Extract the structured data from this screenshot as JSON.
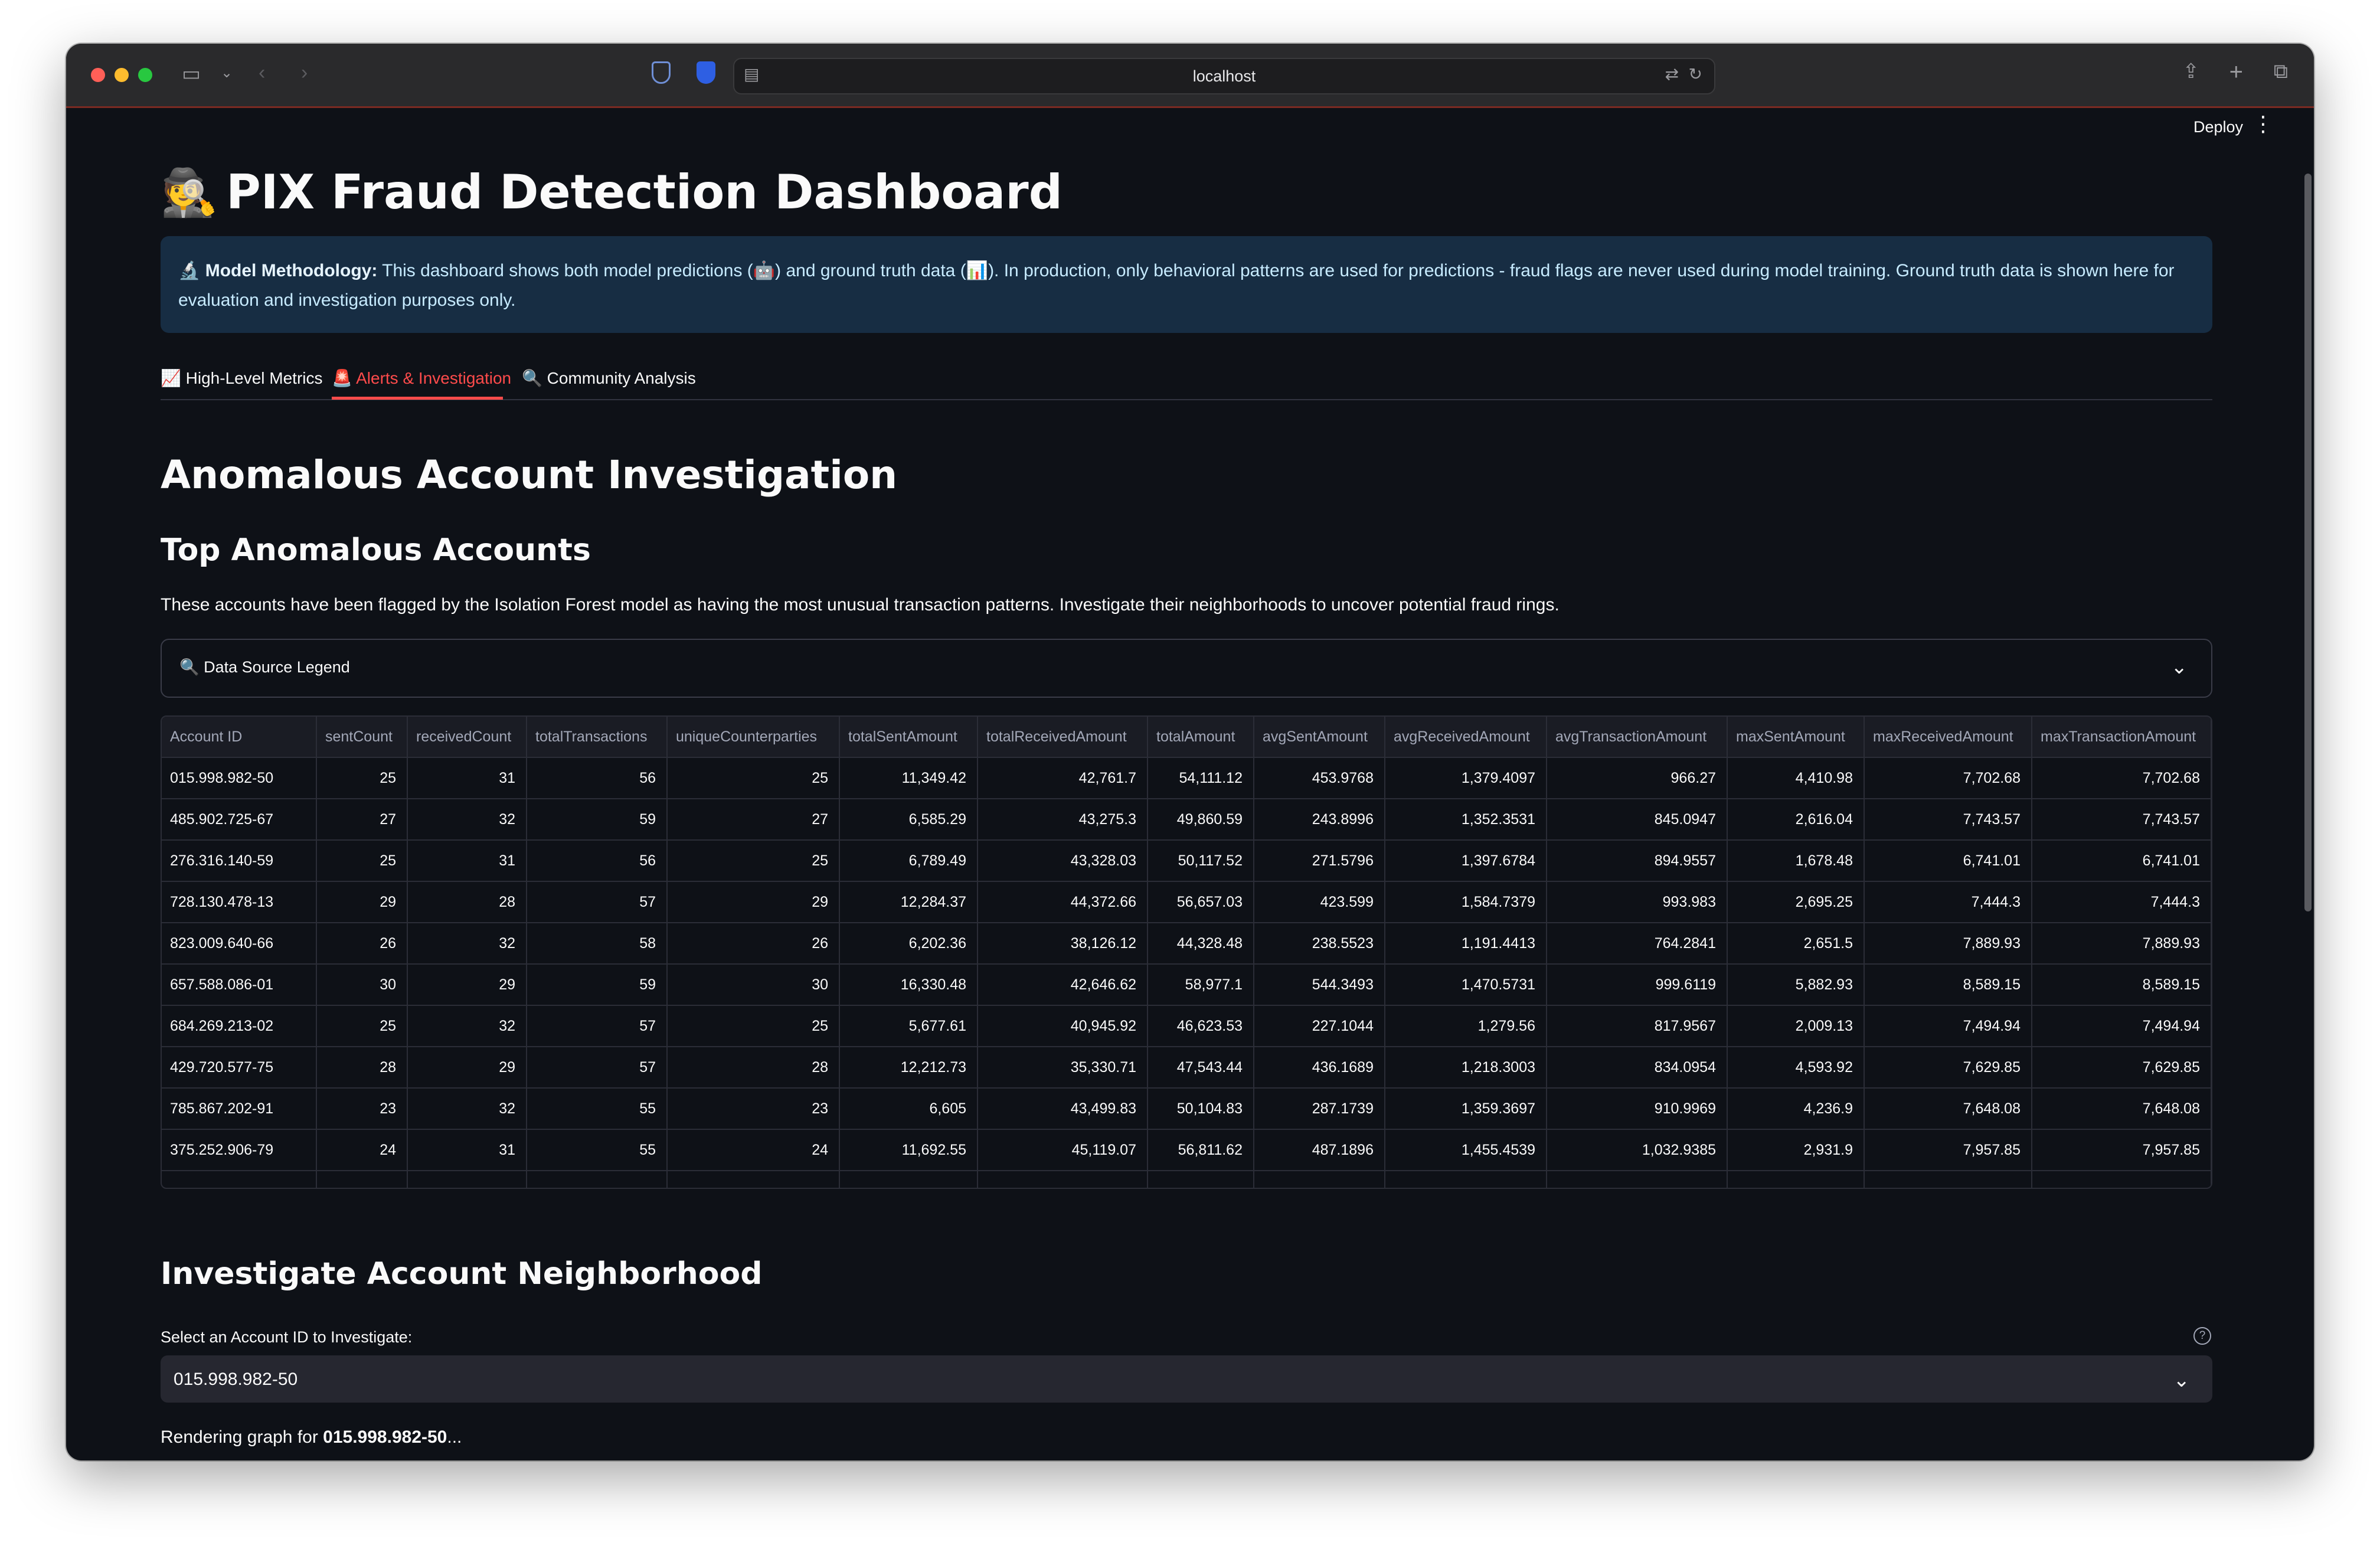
{
  "browser": {
    "url": "localhost"
  },
  "header": {
    "deploy_label": "Deploy"
  },
  "page": {
    "title_icon": "🕵️",
    "title": "PIX Fraud Detection Dashboard",
    "methodology": {
      "icon": "🔬",
      "heading": "Model Methodology:",
      "text_1": " This dashboard shows both model predictions (",
      "robot_icon": "🤖",
      "text_2": ") and ground truth data (",
      "chart_icon": "📊",
      "text_3": "). In production, only behavioral patterns are used for predictions - fraud flags are never used during model training. Ground truth data is shown here for evaluation and investigation purposes only."
    }
  },
  "tabs": [
    {
      "icon": "📈",
      "label": "High-Level Metrics"
    },
    {
      "icon": "🚨",
      "label": "Alerts & Investigation"
    },
    {
      "icon": "🔍",
      "label": "Community Analysis"
    }
  ],
  "section": {
    "heading": "Anomalous Account Investigation",
    "subheading": "Top Anomalous Accounts",
    "description": "These accounts have been flagged by the Isolation Forest model as having the most unusual transaction patterns. Investigate their neighborhoods to uncover potential fraud rings.",
    "legend_icon": "🔍",
    "legend_label": "Data Source Legend"
  },
  "table": {
    "columns": [
      "Account ID",
      "sentCount",
      "receivedCount",
      "totalTransactions",
      "uniqueCounterparties",
      "totalSentAmount",
      "totalReceivedAmount",
      "totalAmount",
      "avgSentAmount",
      "avgReceivedAmount",
      "avgTransactionAmount",
      "maxSentAmount",
      "maxReceivedAmount",
      "maxTransactionAmount"
    ],
    "rows": [
      [
        "015.998.982-50",
        "25",
        "31",
        "56",
        "25",
        "11,349.42",
        "42,761.7",
        "54,111.12",
        "453.9768",
        "1,379.4097",
        "966.27",
        "4,410.98",
        "7,702.68",
        "7,702.68"
      ],
      [
        "485.902.725-67",
        "27",
        "32",
        "59",
        "27",
        "6,585.29",
        "43,275.3",
        "49,860.59",
        "243.8996",
        "1,352.3531",
        "845.0947",
        "2,616.04",
        "7,743.57",
        "7,743.57"
      ],
      [
        "276.316.140-59",
        "25",
        "31",
        "56",
        "25",
        "6,789.49",
        "43,328.03",
        "50,117.52",
        "271.5796",
        "1,397.6784",
        "894.9557",
        "1,678.48",
        "6,741.01",
        "6,741.01"
      ],
      [
        "728.130.478-13",
        "29",
        "28",
        "57",
        "29",
        "12,284.37",
        "44,372.66",
        "56,657.03",
        "423.599",
        "1,584.7379",
        "993.983",
        "2,695.25",
        "7,444.3",
        "7,444.3"
      ],
      [
        "823.009.640-66",
        "26",
        "32",
        "58",
        "26",
        "6,202.36",
        "38,126.12",
        "44,328.48",
        "238.5523",
        "1,191.4413",
        "764.2841",
        "2,651.5",
        "7,889.93",
        "7,889.93"
      ],
      [
        "657.588.086-01",
        "30",
        "29",
        "59",
        "30",
        "16,330.48",
        "42,646.62",
        "58,977.1",
        "544.3493",
        "1,470.5731",
        "999.6119",
        "5,882.93",
        "8,589.15",
        "8,589.15"
      ],
      [
        "684.269.213-02",
        "25",
        "32",
        "57",
        "25",
        "5,677.61",
        "40,945.92",
        "46,623.53",
        "227.1044",
        "1,279.56",
        "817.9567",
        "2,009.13",
        "7,494.94",
        "7,494.94"
      ],
      [
        "429.720.577-75",
        "28",
        "29",
        "57",
        "28",
        "12,212.73",
        "35,330.71",
        "47,543.44",
        "436.1689",
        "1,218.3003",
        "834.0954",
        "4,593.92",
        "7,629.85",
        "7,629.85"
      ],
      [
        "785.867.202-91",
        "23",
        "32",
        "55",
        "23",
        "6,605",
        "43,499.83",
        "50,104.83",
        "287.1739",
        "1,359.3697",
        "910.9969",
        "4,236.9",
        "7,648.08",
        "7,648.08"
      ],
      [
        "375.252.906-79",
        "24",
        "31",
        "55",
        "24",
        "11,692.55",
        "45,119.07",
        "56,811.62",
        "487.1896",
        "1,455.4539",
        "1,032.9385",
        "2,931.9",
        "7,957.85",
        "7,957.85"
      ]
    ]
  },
  "investigate": {
    "heading": "Investigate Account Neighborhood",
    "select_label": "Select an Account ID to Investigate:",
    "selected_value": "015.998.982-50",
    "rendering_prefix": "Rendering graph for ",
    "rendering_account": "015.998.982-50",
    "rendering_suffix": "..."
  },
  "colors": {
    "accent": "#ff4b4b",
    "background": "#0e1117",
    "info_bg": "#172d43"
  }
}
